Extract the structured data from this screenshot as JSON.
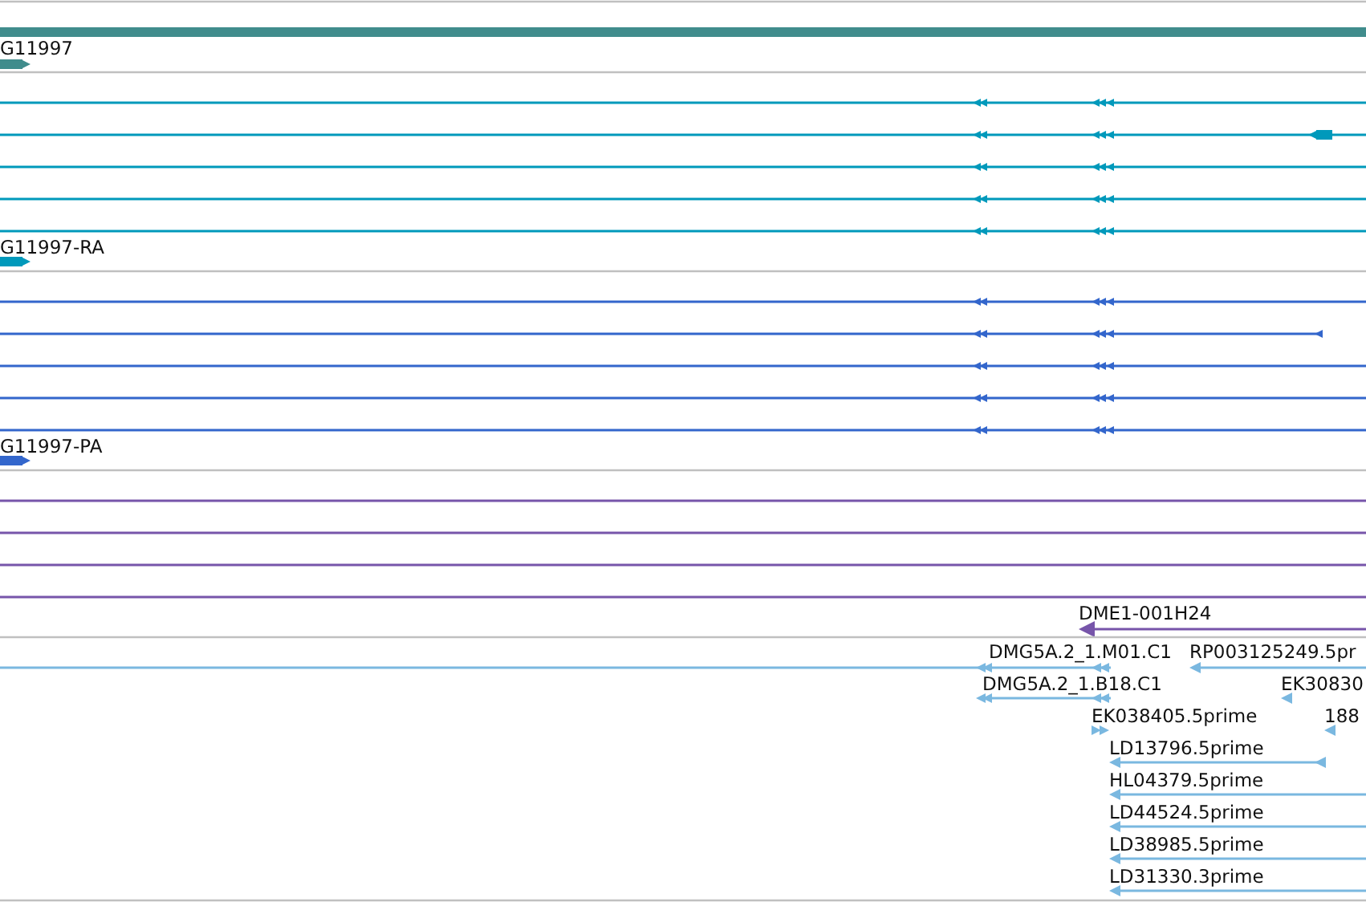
{
  "tracks": [
    {
      "kind": "gene",
      "color": "#408c8c",
      "label": "G11997"
    },
    {
      "kind": "transcripts",
      "color": "#0099bb",
      "label": "G11997-RA",
      "rows": [
        {
          "kind": "full"
        },
        {
          "kind": "block-end"
        },
        {
          "kind": "full"
        },
        {
          "kind": "full"
        },
        {
          "kind": "full"
        }
      ]
    },
    {
      "kind": "transcripts",
      "color": "#3366cc",
      "label": "G11997-PA",
      "rows": [
        {
          "kind": "full"
        },
        {
          "kind": "short-end"
        },
        {
          "kind": "full"
        },
        {
          "kind": "full"
        },
        {
          "kind": "full"
        }
      ]
    },
    {
      "kind": "features",
      "color": "#7755aa",
      "rows": [
        {
          "kind": "full"
        },
        {
          "kind": "full"
        },
        {
          "kind": "full"
        },
        {
          "kind": "full"
        }
      ],
      "features": [
        {
          "label": "DME1-001H24",
          "kind": "reverse"
        }
      ]
    },
    {
      "kind": "features",
      "color": "#7ab8e0",
      "features": [
        {
          "label": "DMG5A.2_1.M01.C1",
          "kind": "spliced"
        },
        {
          "label": "RP003125249.5pr",
          "kind": "reverse"
        },
        {
          "label": "DMG5A.2_1.B18.C1",
          "kind": "spliced"
        },
        {
          "label": "EK30830",
          "kind": "stub"
        },
        {
          "label": "EK038405.5prime",
          "kind": "forward"
        },
        {
          "label": "188",
          "kind": "stub"
        },
        {
          "label": "LD13796.5prime",
          "kind": "reverse"
        },
        {
          "label": "HL04379.5prime",
          "kind": "reverse"
        },
        {
          "label": "LD44524.5prime",
          "kind": "reverse"
        },
        {
          "label": "LD38985.5prime",
          "kind": "reverse"
        },
        {
          "label": "LD31330.3prime",
          "kind": "reverse"
        }
      ]
    }
  ]
}
